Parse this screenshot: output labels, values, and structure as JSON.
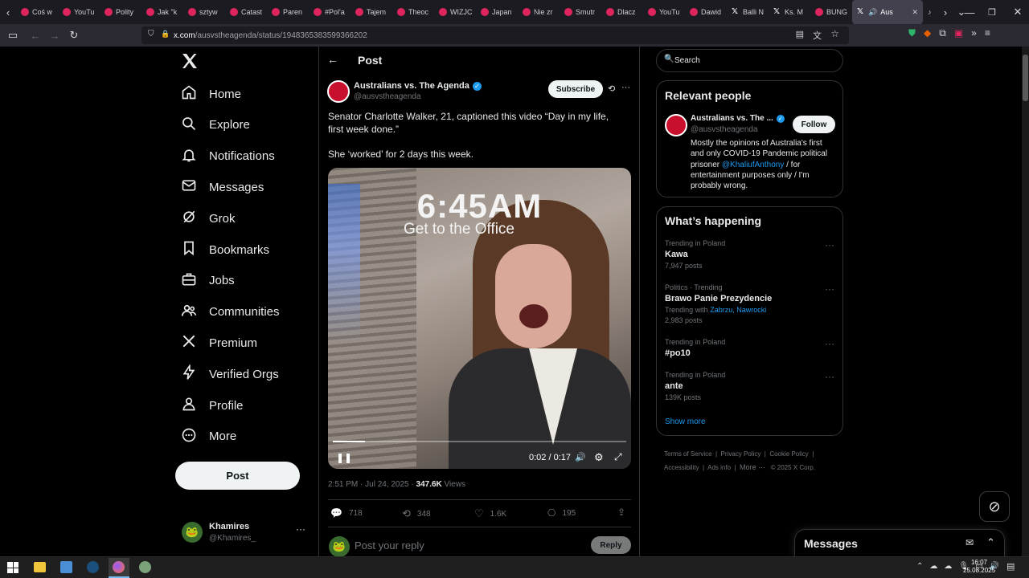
{
  "browser": {
    "tabs": [
      {
        "label": "Coś w",
        "icon": "youtube-icon"
      },
      {
        "label": "YouTu",
        "icon": "youtube-icon"
      },
      {
        "label": "Polity",
        "icon": "youtube-icon"
      },
      {
        "label": "Jak \"k",
        "icon": "youtube-icon"
      },
      {
        "label": "sztyw",
        "icon": "youtube-icon"
      },
      {
        "label": "Catast",
        "icon": "youtube-icon"
      },
      {
        "label": "Paren",
        "icon": "youtube-icon"
      },
      {
        "label": "#Pol'a",
        "icon": "youtube-icon"
      },
      {
        "label": "Tajem",
        "icon": "youtube-icon"
      },
      {
        "label": "Theoc",
        "icon": "youtube-icon"
      },
      {
        "label": "WIZJC",
        "icon": "youtube-icon"
      },
      {
        "label": "Japan",
        "icon": "youtube-icon"
      },
      {
        "label": "Nie zr",
        "icon": "youtube-icon"
      },
      {
        "label": "Smutr",
        "icon": "youtube-icon"
      },
      {
        "label": "Dlacz",
        "icon": "youtube-icon"
      },
      {
        "label": "YouTu",
        "icon": "youtube-icon"
      },
      {
        "label": "Dawid",
        "icon": "youtube-icon"
      },
      {
        "label": "Balli N",
        "icon": "x-icon"
      },
      {
        "label": "Ks. M",
        "icon": "x-icon"
      },
      {
        "label": "BUNG",
        "icon": "youtube-icon"
      }
    ],
    "active_tab": "Aus",
    "url_host": "x.com",
    "url_path": "/ausvstheagenda/status/1948365383599366202"
  },
  "sidebar": {
    "items": [
      {
        "label": "Home",
        "icon": "home-icon"
      },
      {
        "label": "Explore",
        "icon": "search-icon"
      },
      {
        "label": "Notifications",
        "icon": "bell-icon"
      },
      {
        "label": "Messages",
        "icon": "envelope-icon"
      },
      {
        "label": "Grok",
        "icon": "grok-icon"
      },
      {
        "label": "Bookmarks",
        "icon": "bookmark-icon"
      },
      {
        "label": "Jobs",
        "icon": "briefcase-icon"
      },
      {
        "label": "Communities",
        "icon": "people-icon"
      },
      {
        "label": "Premium",
        "icon": "x-icon"
      },
      {
        "label": "Verified Orgs",
        "icon": "lightning-icon"
      },
      {
        "label": "Profile",
        "icon": "person-icon"
      },
      {
        "label": "More",
        "icon": "more-circle-icon"
      }
    ],
    "post_button": "Post",
    "account": {
      "name": "Khamires",
      "handle": "@Khamires_"
    }
  },
  "post": {
    "header_title": "Post",
    "author_name": "Australians vs. The Agenda",
    "author_handle": "@ausvstheagenda",
    "subscribe_label": "Subscribe",
    "text_line1": "Senator Charlotte Walker, 21, captioned this video “Day in my life, first week done.”",
    "text_line2": "She ‘worked’ for 2 days this week.",
    "video": {
      "overlay_time": "6:45AM",
      "overlay_caption": "Get to the Office",
      "time_display": "0:02 / 0:17",
      "progress": 0.11
    },
    "timestamp": "2:51 PM · Jul 24, 2025 · ",
    "views_count": "347.6K",
    "views_label": " Views",
    "stats": {
      "replies": "718",
      "reposts": "348",
      "likes": "1.6K",
      "bookmarks": "195"
    },
    "reply_placeholder": "Post your reply",
    "reply_button": "Reply"
  },
  "search": {
    "placeholder": "Search"
  },
  "relevant": {
    "title": "Relevant people",
    "name": "Australians vs. The ...",
    "handle": "@ausvstheagenda",
    "follow_label": "Follow",
    "bio_part1": "Mostly the opinions of Australia's first and only COVID-19 Pandemic political prisoner ",
    "bio_mention": "@KhaliufAnthony",
    "bio_part2": " / for entertainment purposes only / I'm probably wrong."
  },
  "happening": {
    "title": "What’s happening",
    "trends": [
      {
        "meta": "Trending in Poland",
        "name": "Kawa",
        "count": "7,947 posts"
      },
      {
        "meta": "Politics · Trending",
        "name": "Brawo Panie Prezydencie",
        "with_label": "Trending with ",
        "with_links": "Zabrzu, Nawrocki",
        "count": "2,983 posts"
      },
      {
        "meta": "Trending in Poland",
        "name": "#po10",
        "count": ""
      },
      {
        "meta": "Trending in Poland",
        "name": "ante",
        "count": "139K posts"
      }
    ],
    "show_more": "Show more"
  },
  "footer": {
    "links": [
      "Terms of Service",
      "Privacy Policy",
      "Cookie Policy",
      "Accessibility",
      "Ads info",
      "More ···"
    ],
    "copyright": "© 2025 X Corp."
  },
  "messages_drawer": {
    "title": "Messages"
  },
  "taskbar": {
    "time": "16:07",
    "date": "25.08.2025"
  },
  "colors": {
    "accent": "#1d9bf0",
    "background": "#000000",
    "border": "#2f3336",
    "muted": "#71767b"
  }
}
